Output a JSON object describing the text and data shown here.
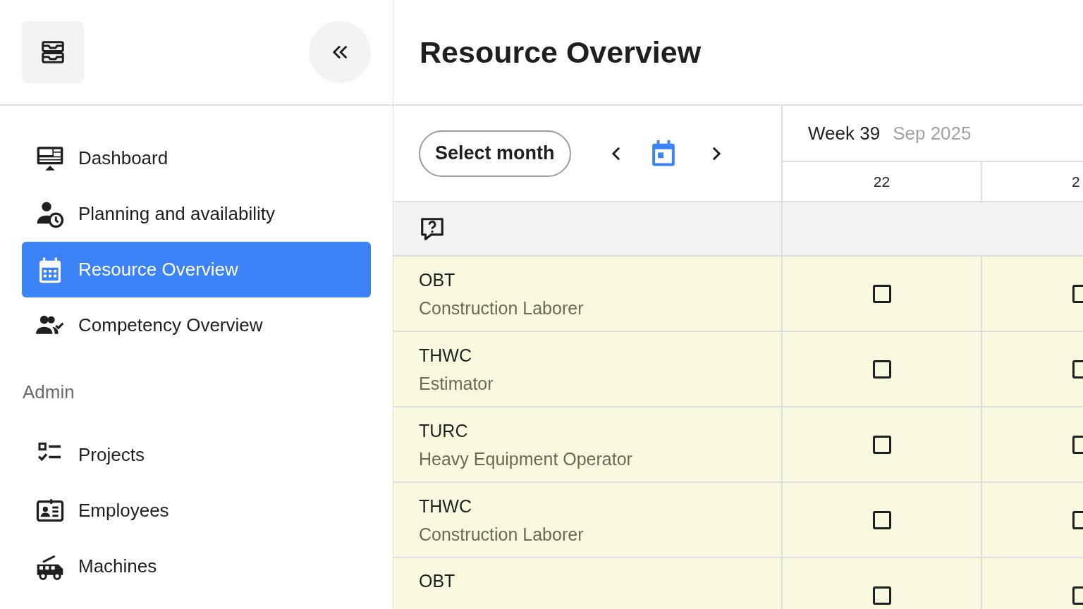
{
  "sidebar": {
    "nav": [
      {
        "kind": "dashboard",
        "label": "Dashboard",
        "selected": false
      },
      {
        "kind": "planning",
        "label": "Planning and availability",
        "selected": false
      },
      {
        "kind": "calendar",
        "label": "Resource Overview",
        "selected": true
      },
      {
        "kind": "competency",
        "label": "Competency Overview",
        "selected": false
      }
    ],
    "section_label": "Admin",
    "admin": [
      {
        "kind": "projects",
        "label": "Projects",
        "selected": false
      },
      {
        "kind": "employees",
        "label": "Employees",
        "selected": false
      },
      {
        "kind": "machines",
        "label": "Machines",
        "selected": false
      }
    ]
  },
  "page_title": "Resource Overview",
  "toolbar": {
    "select_month": "Select month"
  },
  "week": {
    "label": "Week 39",
    "month": "Sep 2025"
  },
  "days": [
    "22",
    "2"
  ],
  "rows": [
    {
      "code": "OBT",
      "role": "Construction Laborer",
      "cells": [
        {
          "checked": false
        },
        {
          "checked": false
        }
      ]
    },
    {
      "code": "THWC",
      "role": "Estimator",
      "cells": [
        {
          "checked": false
        },
        {
          "checked": false
        }
      ]
    },
    {
      "code": "TURC",
      "role": "Heavy Equipment Operator",
      "cells": [
        {
          "checked": false
        },
        {
          "checked": false
        }
      ]
    },
    {
      "code": "THWC",
      "role": "Construction Laborer",
      "cells": [
        {
          "checked": false
        },
        {
          "checked": false
        }
      ]
    },
    {
      "code": "OBT",
      "cells": [
        {
          "checked": false
        },
        {
          "checked": false
        }
      ]
    }
  ]
}
